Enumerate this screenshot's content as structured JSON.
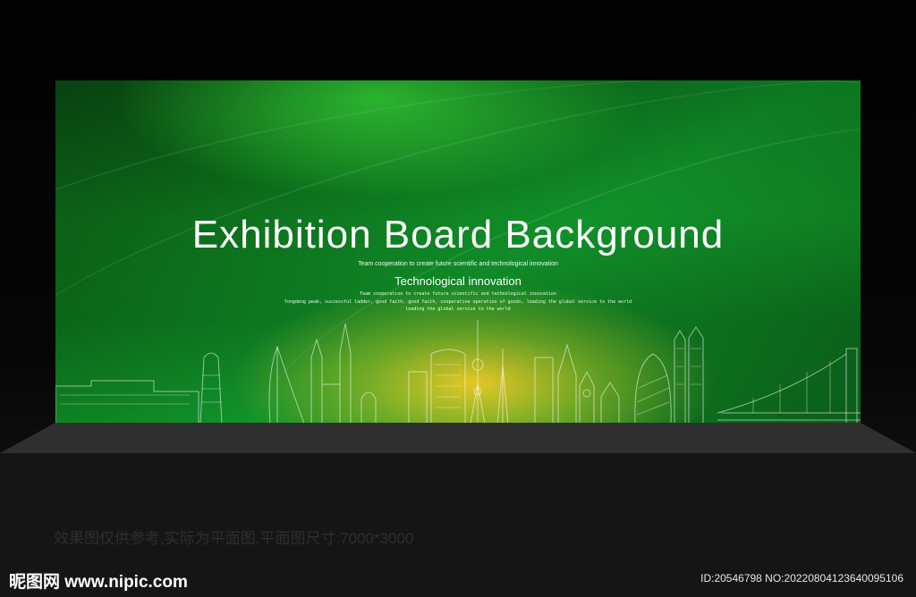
{
  "board": {
    "title": "Exhibition Board Background",
    "tagline": "Team cooperation to create future scientific and technological innovation",
    "subtitle": "Technological innovation",
    "small_line_1": "Team cooperation to create future scientific and technological innovation",
    "small_line_2": "Yongdeng peak, successful ladder, good faith, good faith, cooperative operation of goods, leading the global service to the world",
    "small_line_3": "leading the global service to the world"
  },
  "note": "效果图仅供参考,实际为平面图,平面图尺寸:7000*3000",
  "watermark": {
    "logo": "昵图网 www.nipic.com",
    "image_id": "ID:20546798 NO:20220804123640095106"
  },
  "colors": {
    "board_green": "#11922a",
    "glow_yellow": "#ffd628",
    "stage": "#2f2f2f"
  }
}
